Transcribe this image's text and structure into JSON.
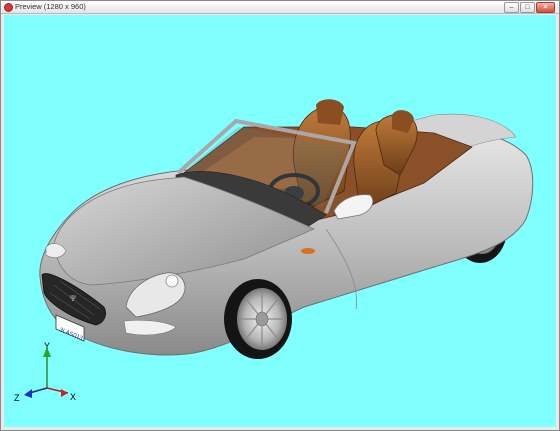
{
  "window": {
    "title": "Preview (1280 x 960)",
    "buttons": {
      "minimize": "–",
      "maximize": "□",
      "close": "✕"
    }
  },
  "viewport": {
    "background_color": "#80ffff",
    "car_color": "#bfbfbf",
    "interior_color": "#a0622d",
    "license_plate": "3LAS013"
  },
  "axis": {
    "y_label": "Y",
    "x_label": "X",
    "z_label": "Z"
  }
}
